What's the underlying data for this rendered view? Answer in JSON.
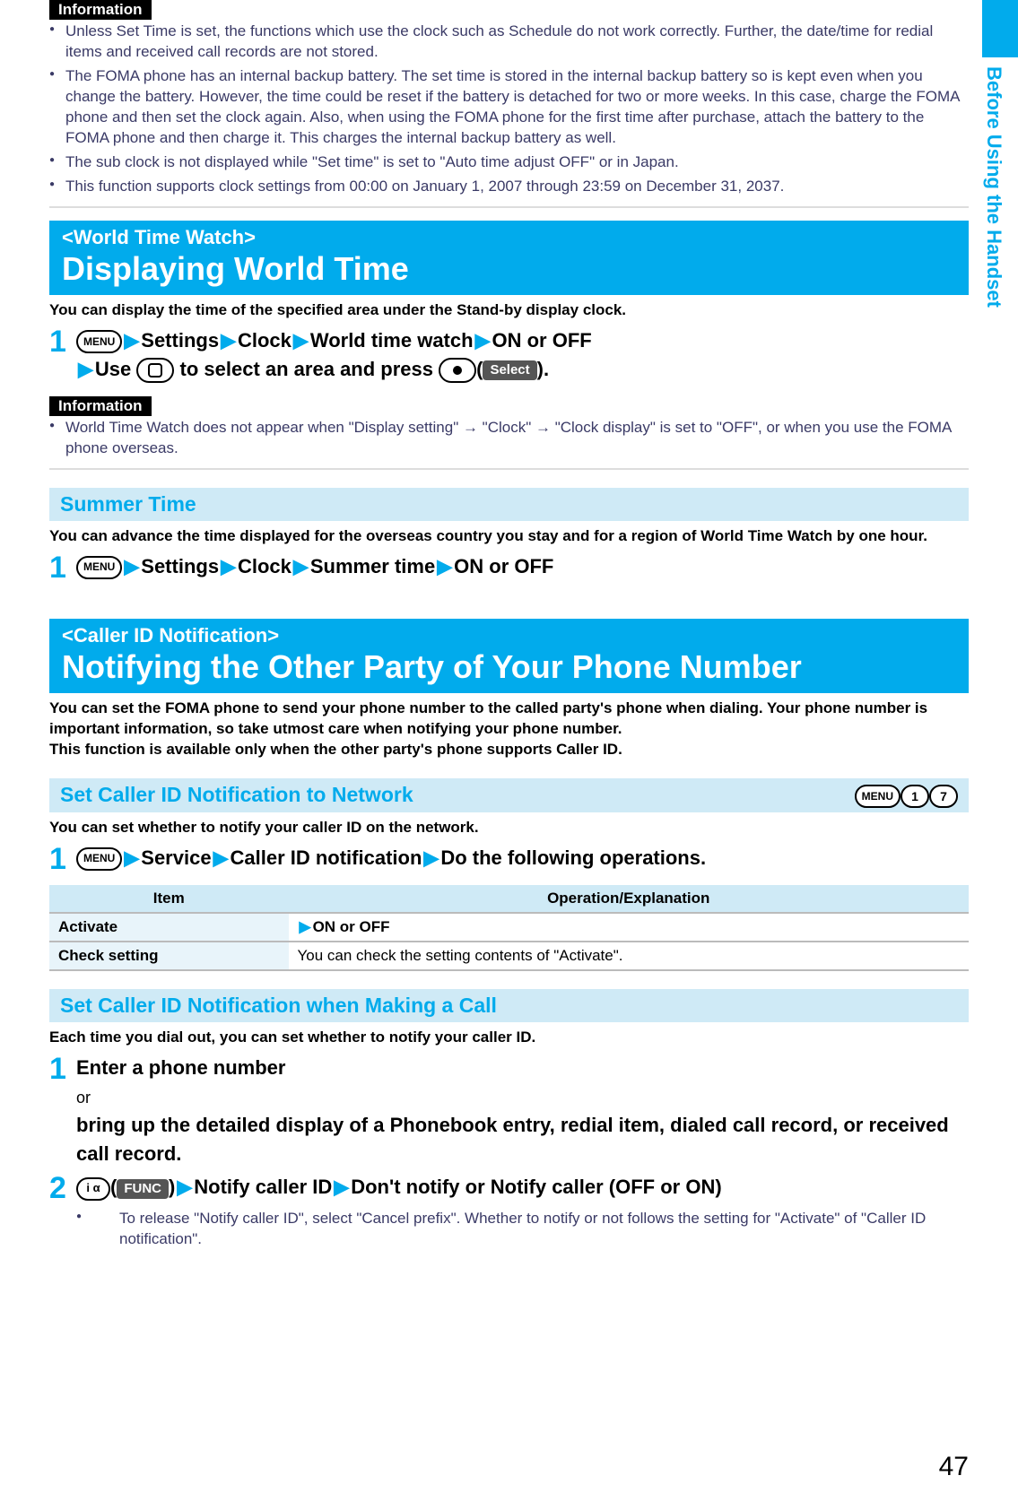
{
  "sideTab": {
    "label": "Before Using the Handset"
  },
  "info1": {
    "label": "Information",
    "items": [
      "Unless Set Time is set, the functions which use the clock such as Schedule do not work correctly. Further, the date/time for redial items and received call records are not stored.",
      "The FOMA phone has an internal backup battery. The set time is stored in the internal backup battery so is kept even when you change the battery. However, the time could be reset if the battery is detached for two or more weeks. In this case, charge the FOMA phone and then set the clock again. Also, when using the FOMA phone for the first time after purchase, attach the battery to the FOMA phone and then charge it. This charges the internal backup battery as well.",
      "The sub clock is not displayed while \"Set time\" is set to \"Auto time adjust OFF\" or in Japan.",
      "This function supports clock settings from 00:00 on January 1, 2007 through 23:59 on December 31, 2037."
    ]
  },
  "worldTime": {
    "tag": "<World Time Watch>",
    "title": "Displaying World Time",
    "intro": "You can display the time of the specified area under the Stand-by display clock.",
    "step1": {
      "num": "1",
      "menuKey": "MENU",
      "p1": "Settings",
      "p2": "Clock",
      "p3": "World time watch",
      "p4": "ON or OFF",
      "line2a": "Use",
      "line2b": "to select an area and press",
      "select": "Select",
      "end": "."
    }
  },
  "info2": {
    "label": "Information",
    "items": [
      "World Time Watch does not appear when \"Display setting\" → \"Clock\" → \"Clock display\" is set to \"OFF\", or when you use the FOMA phone overseas."
    ]
  },
  "summer": {
    "heading": "Summer Time",
    "intro": "You can advance the time displayed for the overseas country you stay and for a region of World Time Watch by one hour.",
    "step1": {
      "num": "1",
      "menuKey": "MENU",
      "p1": "Settings",
      "p2": "Clock",
      "p3": "Summer time",
      "p4": "ON or OFF"
    }
  },
  "callerId": {
    "tag": "<Caller ID Notification>",
    "title": "Notifying the Other Party of Your Phone Number",
    "intro": "You can set the FOMA phone to send your phone number to the called party's phone when dialing. Your phone number is important information, so take utmost care when notifying your phone number.\nThis function is available only when the other party's phone supports Caller ID."
  },
  "setNetwork": {
    "heading": "Set Caller ID Notification to Network",
    "shortcut": {
      "menu": "MENU",
      "k1": "1",
      "k2": "7"
    },
    "intro": "You can set whether to notify your caller ID on the network.",
    "step1": {
      "num": "1",
      "menuKey": "MENU",
      "p1": "Service",
      "p2": "Caller ID notification",
      "p3": "Do the following operations."
    },
    "table": {
      "head": {
        "c1": "Item",
        "c2": "Operation/Explanation"
      },
      "rows": [
        {
          "c1": "Activate",
          "c2": "ON or OFF",
          "arrow": true
        },
        {
          "c1": "Check setting",
          "c2": "You can check the setting contents of \"Activate\".",
          "arrow": false
        }
      ]
    }
  },
  "setCall": {
    "heading": "Set Caller ID Notification when Making a Call",
    "intro": "Each time you dial out, you can set whether to notify your caller ID.",
    "step1": {
      "num": "1",
      "line1": "Enter a phone number",
      "or": "or",
      "line2": "bring up the detailed display of a Phonebook entry, redial item, dialed call record, or received call record."
    },
    "step2": {
      "num": "2",
      "funcKey": "i α",
      "funcLabel": "FUNC",
      "p1": "Notify caller ID",
      "p2": "Don't notify or Notify caller (OFF or ON)",
      "note": "To release \"Notify caller ID\", select \"Cancel prefix\". Whether to notify or not follows the setting for \"Activate\" of \"Caller ID notification\"."
    }
  },
  "pageNum": "47"
}
